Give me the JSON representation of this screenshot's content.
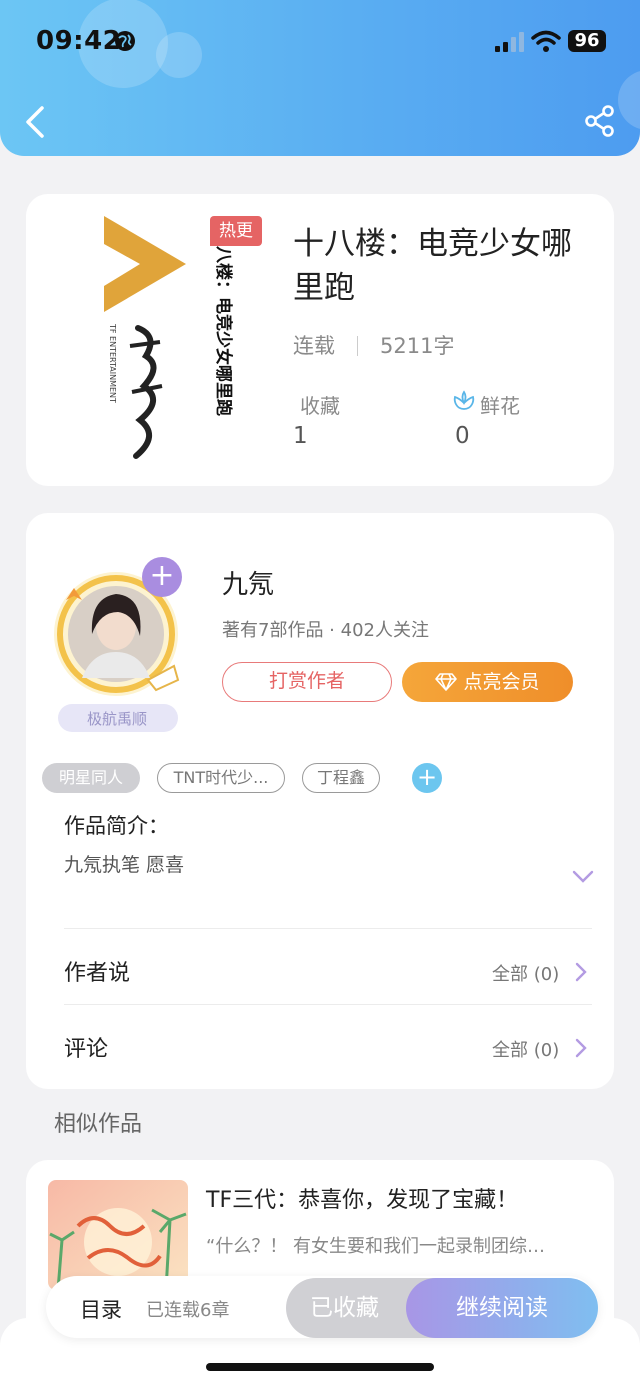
{
  "status_bar": {
    "time": "09:42",
    "battery": "96"
  },
  "book": {
    "badge": "热更",
    "title": "十八楼：电竞少女哪里跑",
    "status": "连载",
    "word_count": "5211字",
    "favorites_label": "收藏",
    "favorites_value": "1",
    "flowers_label": "鲜花",
    "flowers_value": "0",
    "cover_logo_text": "TF ENTERTAINMENT",
    "cover_spine_text": "八楼：电竞少女哪里跑",
    "colors": {
      "cover_triangle": "#e0a43a",
      "badge": "#e56464"
    }
  },
  "author": {
    "name": "九氖",
    "stats": "著有7部作品 · 402人关注",
    "badge": "极航禹顺",
    "reward_label": "打赏作者",
    "vip_label": "点亮会员"
  },
  "tags": [
    "明星同人",
    "TNT时代少...",
    "丁程鑫"
  ],
  "intro": {
    "label": "作品简介：",
    "text": "九氖执笔 愿喜"
  },
  "rows": [
    {
      "label": "作者说",
      "right": "全部 (0)"
    },
    {
      "label": "评论",
      "right": "全部 (0)"
    }
  ],
  "similar": {
    "section_title": "相似作品",
    "items": [
      {
        "title": "TF三代：恭喜你，发现了宝藏！",
        "desc": "“什么？！ 有女生要和我们一起录制团综…"
      }
    ]
  },
  "bottom": {
    "toc_label": "目录",
    "toc_count": "已连载6章",
    "fav_label": "已收藏",
    "read_label": "继续阅读"
  },
  "icons": [
    "back-icon",
    "share-icon",
    "globe-icon",
    "signal-icon",
    "wifi-icon",
    "flower-icon",
    "plus-icon",
    "gem-icon",
    "chevron-down-icon",
    "chevron-right-icon"
  ],
  "accent_colors": {
    "header_start": "#6cc6f4",
    "header_end": "#4d9cf0",
    "vip": "#f5a63a",
    "read_start": "#a896e6",
    "read_end": "#7fbef0"
  }
}
